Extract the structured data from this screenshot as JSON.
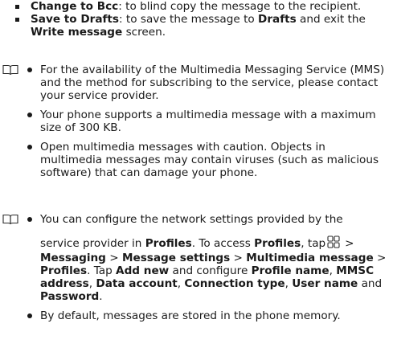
{
  "top": {
    "item1": {
      "term": "Change to Bcc",
      "desc": ": to blind copy the message to the recipient."
    },
    "item2": {
      "term": "Save to Drafts",
      "desc_a": ": to save the message to ",
      "target": "Drafts",
      "desc_b": " and exit the ",
      "screen": "Write message",
      "desc_c": " screen."
    }
  },
  "note1": {
    "icon": "note-book-icon",
    "bullets": [
      "For the availability of the Multimedia Messaging Service (MMS) and the method for subscribing to the service, please contact your service provider.",
      "Your phone supports a multimedia message with a maximum size of 300 KB.",
      "Open multimedia messages with caution. Objects in multimedia messages may contain viruses (such as malicious software) that can damage your phone."
    ]
  },
  "note2": {
    "icon": "note-book-icon",
    "bullet1": {
      "line1": "You can configure the network settings provided by the",
      "t_a": "service provider in ",
      "profiles1": "Profiles",
      "t_b": ". To access ",
      "profiles2": "Profiles",
      "t_c": ", tap",
      "apps_icon": "apps-grid-icon",
      "t_d": ">",
      "messaging": "Messaging",
      "sep1": " > ",
      "message_settings": "Message settings",
      "sep2": " > ",
      "multimedia_message": "Multimedia message",
      "sep3": " >",
      "profiles3": "Profiles",
      "t_e": ". Tap ",
      "add_new": "Add new",
      "t_f": " and configure ",
      "profile_name": "Profile name",
      "t_g": ", ",
      "mmsc_address": "MMSC address",
      "t_h": ", ",
      "data_account": "Data account",
      "t_i": ", ",
      "connection_type": "Connection type",
      "t_j": ", ",
      "user_name": "User name",
      "t_k": " and",
      "password": "Password",
      "t_l": "."
    },
    "bullet2": "By default, messages are stored in the phone memory."
  },
  "colors": {
    "text": "#1a1a1a",
    "icon_stroke": "#2b2b2b"
  }
}
